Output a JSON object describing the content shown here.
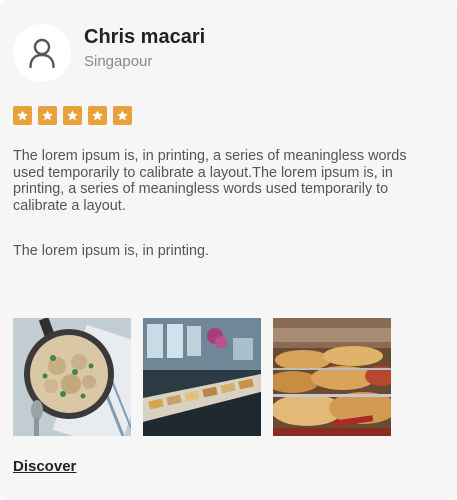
{
  "reviewer": {
    "name": "Chris macari",
    "location": "Singapour"
  },
  "rating": {
    "value": 5,
    "max": 5,
    "color": "#e9a23b"
  },
  "review": {
    "paragraph_1": "The lorem ipsum is, in printing, a series of meaningless words used temporarily to calibrate a layout.The lorem ipsum is, in printing, a series of meaningless words used temporarily to calibrate a layout.",
    "paragraph_2": "The lorem ipsum is, in printing."
  },
  "photos": [
    {
      "icon": "food-pan-photo"
    },
    {
      "icon": "buffet-hall-photo"
    },
    {
      "icon": "buffet-trays-photo"
    }
  ],
  "actions": {
    "discover_label": "Discover"
  }
}
